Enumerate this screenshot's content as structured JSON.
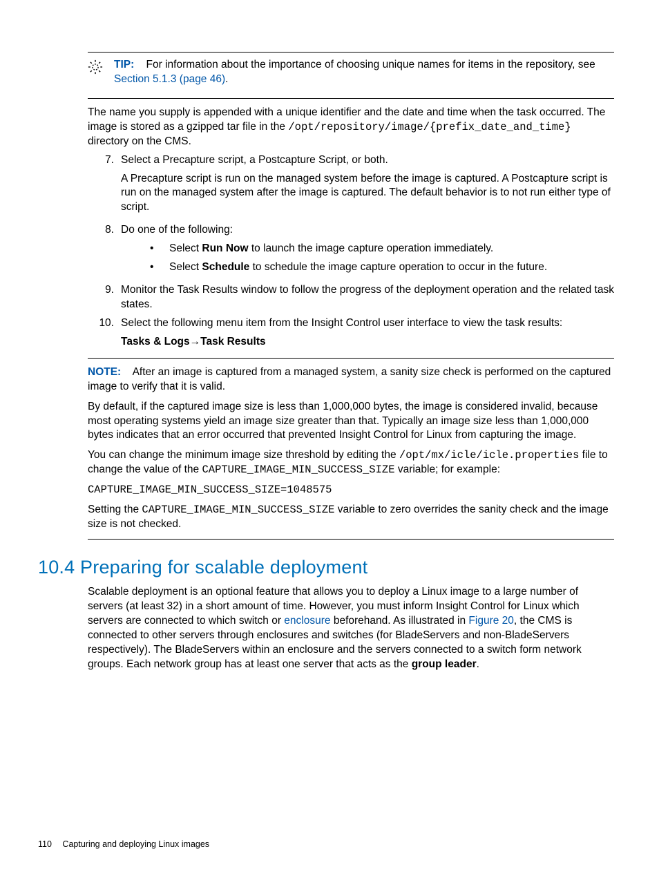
{
  "tip": {
    "label": "TIP:",
    "text_before": "For information about the importance of choosing unique names for items in the repository, see ",
    "link": "Section 5.1.3 (page 46)",
    "text_after": "."
  },
  "tip_para_1a": "The name you supply is appended with a unique identifier and the date and time when the task occurred. The image is stored as a gzipped tar file in the ",
  "tip_para_1b": "/opt/repository/image/{prefix_date_and_time}",
  "tip_para_1c": " directory on the CMS.",
  "step7": {
    "num": "7.",
    "line1": "Select a Precapture script, a Postcapture Script, or both.",
    "para": "A Precapture script is run on the managed system before the image is captured. A Postcapture script is run on the managed system after the image is captured. The default behavior is to not run either type of script."
  },
  "step8": {
    "num": "8.",
    "line1": "Do one of the following:",
    "b1a": "Select ",
    "b1b": "Run Now",
    "b1c": " to launch the image capture operation immediately.",
    "b2a": "Select ",
    "b2b": "Schedule",
    "b2c": " to schedule the image capture operation to occur in the future."
  },
  "step9": {
    "num": "9.",
    "text": "Monitor the Task Results window to follow the progress of the deployment operation and the related task states."
  },
  "step10": {
    "num": "10.",
    "line1": "Select the following menu item from the Insight Control user interface to view the task results:",
    "menu": "Tasks & Logs→Task Results"
  },
  "note": {
    "label": "NOTE:",
    "p1": "After an image is captured from a managed system, a sanity size check is performed on the captured image to verify that it is valid.",
    "p2": "By default, if the captured image size is less than 1,000,000 bytes, the image is considered invalid, because most operating systems yield an image size greater than that. Typically an image size less than 1,000,000 bytes indicates that an error occurred that prevented Insight Control for Linux from capturing the image.",
    "p3a": "You can change the minimum image size threshold by editing the ",
    "p3b": "/opt/mx/icle/icle.properties",
    "p3c": " file to change the value of the ",
    "p3d": "CAPTURE_IMAGE_MIN_SUCCESS_SIZE",
    "p3e": " variable; for example:",
    "code": "CAPTURE_IMAGE_MIN_SUCCESS_SIZE=1048575",
    "p4a": "Setting the ",
    "p4b": "CAPTURE_IMAGE_MIN_SUCCESS_SIZE",
    "p4c": " variable to zero overrides the sanity check and the image size is not checked."
  },
  "section": {
    "heading": "10.4 Preparing for scalable deployment",
    "p1a": "Scalable deployment is an optional feature that allows you to deploy a Linux image to a large number of servers (at least 32) in a short amount of time. However, you must inform Insight Control for Linux which servers are connected to which switch or ",
    "link1": "enclosure",
    "p1b": " beforehand. As illustrated in ",
    "link2": "Figure 20",
    "p1c": ", the CMS is connected to other servers through enclosures and switches (for BladeServers and non-BladeServers respectively). The BladeServers within an enclosure and the servers connected to a switch form network groups. Each network group has at least one server that acts as the ",
    "p1d": "group leader",
    "p1e": "."
  },
  "footer": {
    "page": "110",
    "title": "Capturing and deploying Linux images"
  }
}
